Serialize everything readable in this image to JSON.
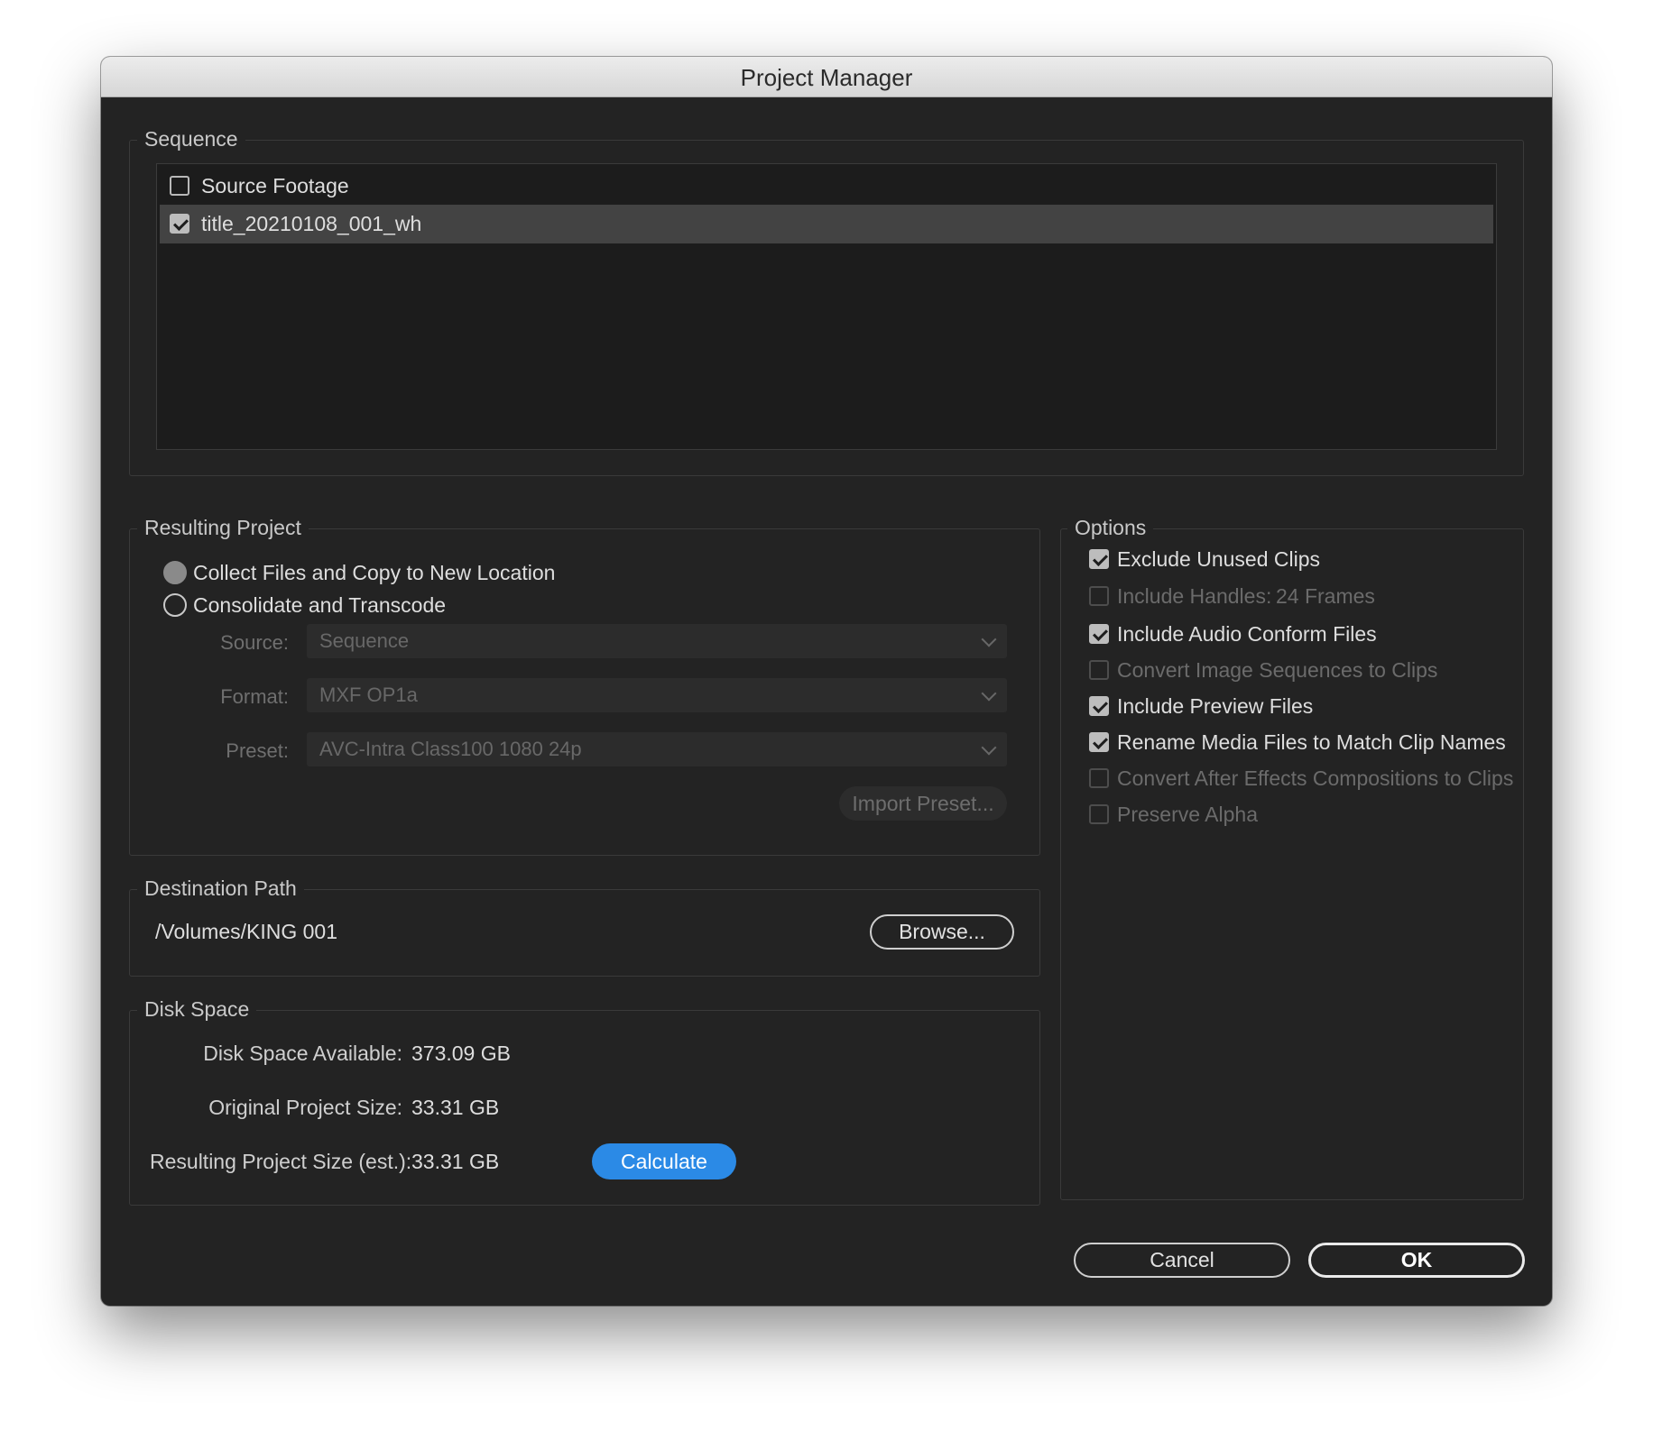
{
  "window": {
    "title": "Project Manager"
  },
  "sequence": {
    "legend": "Sequence",
    "items": [
      {
        "label": "Source Footage",
        "checked": false
      },
      {
        "label": "title_20210108_001_wh",
        "checked": true,
        "selected": true
      }
    ]
  },
  "resulting_project": {
    "legend": "Resulting Project",
    "collect_label": "Collect Files and Copy to New Location",
    "consolidate_label": "Consolidate and Transcode",
    "selected": "collect",
    "source": {
      "label": "Source:",
      "value": "Sequence"
    },
    "format": {
      "label": "Format:",
      "value": "MXF OP1a"
    },
    "preset": {
      "label": "Preset:",
      "value": "AVC-Intra Class100 1080 24p"
    },
    "import_preset_label": "Import Preset..."
  },
  "destination": {
    "legend": "Destination Path",
    "path": "/Volumes/KING 001",
    "browse_label": "Browse..."
  },
  "disk_space": {
    "legend": "Disk Space",
    "available_label": "Disk Space Available:",
    "available_value": "373.09 GB",
    "original_label": "Original Project Size:",
    "original_value": "33.31 GB",
    "resulting_label": "Resulting Project Size (est.):",
    "resulting_value": "33.31 GB",
    "calculate_label": "Calculate"
  },
  "options": {
    "legend": "Options",
    "items": [
      {
        "label": "Exclude Unused Clips",
        "checked": true,
        "enabled": true
      },
      {
        "label": "Include Handles:",
        "value": "24 Frames",
        "checked": false,
        "enabled": false
      },
      {
        "label": "Include Audio Conform Files",
        "checked": true,
        "enabled": true
      },
      {
        "label": "Convert Image Sequences to Clips",
        "checked": false,
        "enabled": false
      },
      {
        "label": "Include Preview Files",
        "checked": true,
        "enabled": true
      },
      {
        "label": "Rename Media Files to Match Clip Names",
        "checked": true,
        "enabled": true
      },
      {
        "label": "Convert After Effects Compositions to Clips",
        "checked": false,
        "enabled": false
      },
      {
        "label": "Preserve Alpha",
        "checked": false,
        "enabled": false
      }
    ]
  },
  "footer": {
    "cancel_label": "Cancel",
    "ok_label": "OK"
  },
  "colors": {
    "accent": "#2b8ae6",
    "background": "#232323"
  }
}
